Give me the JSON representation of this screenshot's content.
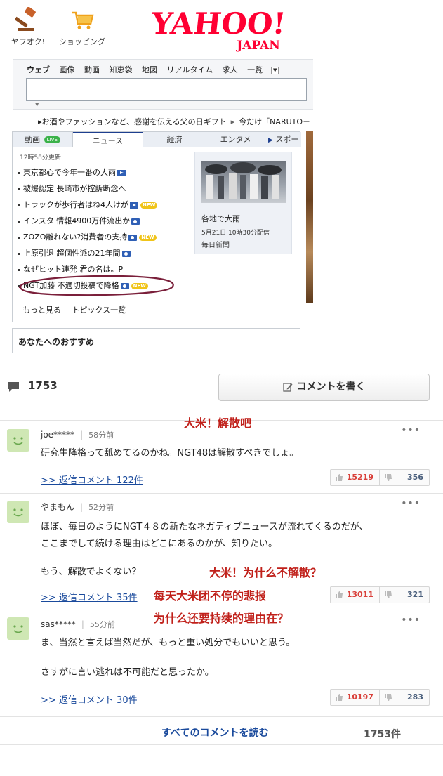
{
  "header": {
    "services": [
      {
        "label": "ヤフオク!",
        "icon": "auction-gavel-icon"
      },
      {
        "label": "ショッピング",
        "icon": "shopping-cart-icon"
      }
    ],
    "logo": {
      "main": "YAHOO!",
      "sub": "JAPAN",
      "color": "#ff0033"
    }
  },
  "search": {
    "tabs": [
      "ウェブ",
      "画像",
      "動画",
      "知恵袋",
      "地図",
      "リアルタイム",
      "求人",
      "一覧"
    ],
    "active_tab": "ウェブ",
    "placeholder": ""
  },
  "promos": [
    "お酒やファッションなど、感謝を伝える父の日ギフト",
    "今だけ「NARUTO－"
  ],
  "news": {
    "tabs": [
      {
        "label": "動画",
        "badge": "LIVE"
      },
      {
        "label": "ニュース",
        "badge": ""
      },
      {
        "label": "経済",
        "badge": ""
      },
      {
        "label": "エンタメ",
        "badge": ""
      },
      {
        "label": "スポー",
        "badge": ""
      }
    ],
    "updated": "12時58分更新",
    "headlines": [
      {
        "text": "東京都心で今年一番の大雨",
        "icon": "video",
        "new": false
      },
      {
        "text": "被爆認定 長崎市が控訴断念へ",
        "icon": "",
        "new": false
      },
      {
        "text": "トラックが歩行者はね4人けが",
        "icon": "video",
        "new": true
      },
      {
        "text": "インスタ 情報4900万件流出か",
        "icon": "photo",
        "new": false
      },
      {
        "text": "ZOZO離れない?消費者の支持",
        "icon": "photo",
        "new": true
      },
      {
        "text": "上原引退 超個性派の21年間",
        "icon": "photo",
        "new": false
      },
      {
        "text": "なぜヒット連発 君の名は。P",
        "icon": "",
        "new": false
      },
      {
        "text": "NGT加藤 不適切投稿で降格",
        "icon": "photo",
        "new": true
      }
    ],
    "new_label": "NEW",
    "more": "もっと見る",
    "topics": "トピックス一覧",
    "feature": {
      "title": "各地で大雨",
      "date": "5月21日 10時30分配信",
      "source": "毎日新聞"
    },
    "highlight_color": "#7a1f3a"
  },
  "recommend_title": "あなたへのおすすめ",
  "comments": {
    "total": "1753",
    "write_button": "コメントを書く",
    "items": [
      {
        "user": "joe*****",
        "time": "58分前",
        "lines": [
          "研究生降格って舐めてるのかね。NGT48は解散すべきでしょ。"
        ],
        "reply": ">> 返信コメント 122件",
        "up": "15219",
        "down": "356"
      },
      {
        "user": "やまもん",
        "time": "52分前",
        "lines": [
          "ほぼ、毎日のようにNGT４８の新たなネガティブニュースが流れてくるのだが、",
          "ここまでして続ける理由はどこにあるのかが、知りたい。",
          "",
          "もう、解散でよくない？"
        ],
        "reply": ">> 返信コメント 35件",
        "up": "13011",
        "down": "321"
      },
      {
        "user": "sas*****",
        "time": "55分前",
        "lines": [
          "ま、当然と言えば当然だが、もっと重い処分でもいいと思う。",
          "",
          "さすがに言い逃れは不可能だと思ったか。"
        ],
        "reply": ">> 返信コメント 30件",
        "up": "10197",
        "down": "283"
      }
    ],
    "read_all": "すべてのコメントを読む",
    "read_all_count": "1753件"
  },
  "annotations": [
    "大米！解散吧",
    "大米！为什么不解散？",
    "每天大米团不停的悲报",
    "为什么还要持续的理由在？"
  ],
  "colors": {
    "link": "#1a4a9c",
    "upvote": "#d9403a",
    "annotation": "#c0201a",
    "avatar": "#cfe7b4"
  }
}
